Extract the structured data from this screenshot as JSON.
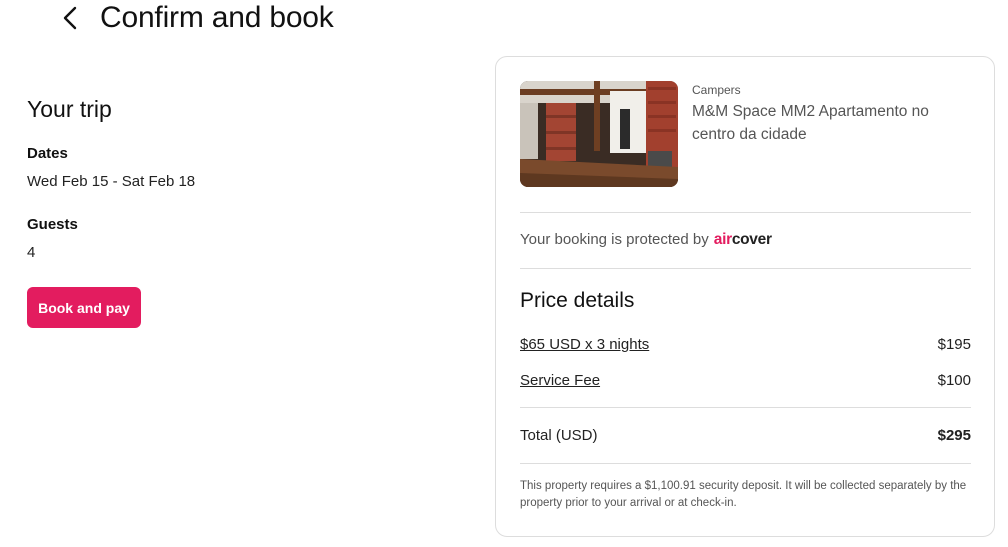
{
  "header": {
    "title": "Confirm and book",
    "back_icon": "chevron-left-icon"
  },
  "trip": {
    "heading": "Your trip",
    "dates_label": "Dates",
    "dates_value": "Wed Feb 15 - Sat Feb 18",
    "guests_label": "Guests",
    "guests_value": "4",
    "book_button": "Book and pay"
  },
  "listing": {
    "type": "Campers",
    "name": "M&M Space MM2 Apartamento no centro da cidade"
  },
  "protection": {
    "text": "Your booking is protected by",
    "brand_air": "air",
    "brand_cover": "cover"
  },
  "price": {
    "heading": "Price details",
    "nights_label": "$65 USD x 3 nights",
    "nights_amount": "$195",
    "fee_label": "Service Fee",
    "fee_amount": "$100",
    "total_label": "Total (USD)",
    "total_amount": "$295",
    "deposit_note": "This property requires a $1,100.91 security deposit. It will be collected separately by the property prior to your arrival or at check-in."
  },
  "colors": {
    "accent": "#e31c5f",
    "text": "#222222",
    "muted": "#555555",
    "border": "#dddddd"
  }
}
